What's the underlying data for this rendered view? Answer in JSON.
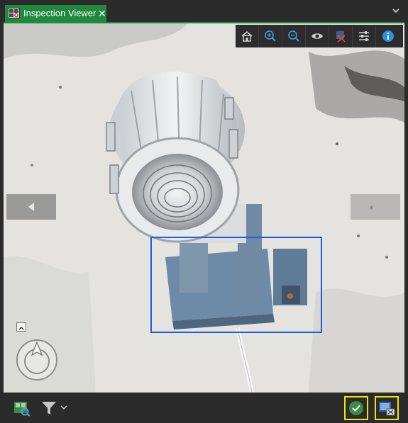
{
  "window": {
    "tab_title": "Inspection Viewer",
    "tab_icon": "inspection-viewer-icon",
    "close_icon": "close-icon",
    "options_icon": "chevron-down-icon",
    "accent_color": "#1f8a3d"
  },
  "viewer": {
    "toolbar": [
      {
        "name": "full-extent",
        "icon": "home-icon"
      },
      {
        "name": "zoom-in",
        "icon": "zoom-in-icon"
      },
      {
        "name": "zoom-out",
        "icon": "zoom-out-icon"
      },
      {
        "name": "visibility",
        "icon": "eye-icon"
      },
      {
        "name": "clear-selection",
        "icon": "clear-selection-icon"
      },
      {
        "name": "adjustments",
        "icon": "sliders-icon"
      },
      {
        "name": "information",
        "icon": "info-icon"
      }
    ],
    "previous_icon": "arrow-left-icon",
    "next_icon": "arrow-right-icon",
    "selection_box_color": "#1a5fe0",
    "compass_icon": "north-arrow-icon"
  },
  "bottom_bar": {
    "layer_icon": "zoom-to-layer-icon",
    "filter_icon": "filter-icon",
    "filter_dropdown_icon": "chevron-down-icon",
    "approve_icon": "checkmark-icon",
    "export_icon": "export-icon",
    "highlight_color": "#f2e400"
  }
}
